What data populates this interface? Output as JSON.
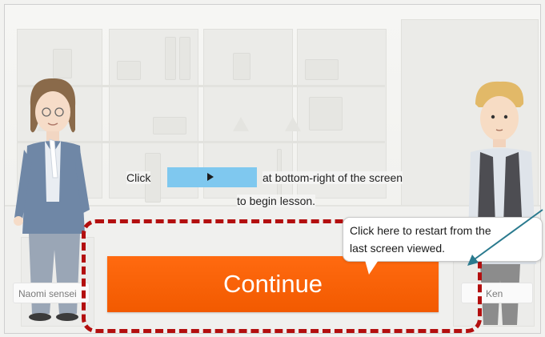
{
  "instruction": {
    "click_word": "Click",
    "after_button": "at bottom-right of the screen",
    "line2": "to begin lesson."
  },
  "characters": {
    "left_name": "Naomi sensei",
    "right_name": "Ken"
  },
  "continue_button": {
    "label": "Continue"
  },
  "tooltip": {
    "line1": "Click here to restart from the",
    "line2": "last screen viewed."
  },
  "colors": {
    "continue_bg": "#f25a00",
    "dash_border": "#b30f0f",
    "play_swatch": "#7fc8ef",
    "arrow": "#2a7a8e"
  },
  "icons": {
    "play": "play-icon"
  }
}
